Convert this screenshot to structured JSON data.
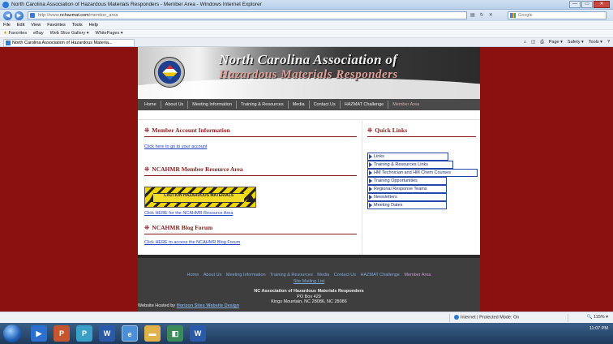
{
  "window": {
    "title": "North Carolina Association of Hazardous Materials Responders - Member Area - Windows Internet Explorer",
    "controls": [
      "—",
      "▭",
      "✕"
    ]
  },
  "address_bar": {
    "url_prefix": "http://www.",
    "url_domain": "nchazmat.com",
    "url_path": "/member_area",
    "search_placeholder": "Google"
  },
  "menu": [
    "File",
    "Edit",
    "View",
    "Favorites",
    "Tools",
    "Help"
  ],
  "favorites_bar": {
    "favorites_label": "Favorites",
    "items": [
      "eBay",
      "Web Slice Gallery ▾",
      "WhitePages ▾"
    ]
  },
  "tab": {
    "title": "North Carolina Association of Hazardous Materia..."
  },
  "command_bar": [
    "Page ▾",
    "Safety ▾",
    "Tools ▾"
  ],
  "site": {
    "banner_line1": "North Carolina Association of",
    "banner_line2": "Hazardous Materials Responders",
    "nav": [
      "Home",
      "About Us",
      "Meeting Information",
      "Training & Resources",
      "Media",
      "Contact Us",
      "HAZMAT Challenge",
      "Member Area"
    ],
    "sections": {
      "account": {
        "heading": "Member Account Information",
        "link": "Click here to go to your account"
      },
      "resources": {
        "heading": "NCAHMR Member Resource Area",
        "image_text": "CAUTION HAZARDOUS MATERIALS",
        "link": "Click HERE for the NCAHMR Resource Area"
      },
      "blog": {
        "heading": "NCAHMR Blog Forum",
        "link": "Click HERE to access the NCAHMR Blog Forum"
      }
    },
    "quick_links": {
      "heading": "Quick Links",
      "items": [
        "Links",
        "Training & Resources Links",
        "HM Technician and HM Chem Courses",
        "Training Opportunities",
        "Regional Response Teams",
        "Newsletters",
        "Meeting Dates"
      ]
    },
    "footer": {
      "nav": [
        "Home",
        "About Us",
        "Meeting Information",
        "Training & Resources",
        "Media",
        "Contact Us",
        "HAZMAT Challenge",
        "Member Area"
      ],
      "mailing_list": "Site Mailing List",
      "org_name": "NC Association of Hazardous Materials Responders",
      "po_box": "PO Box 429",
      "city": "Kings Mountain, NC 28086, NC 28086",
      "hosted_prefix": "Website Hosted by",
      "hosted_link": "Horizon Sites Website Design"
    }
  },
  "status_bar": {
    "zone": "Internet | Protected Mode: On",
    "zoom": "115%"
  },
  "taskbar": {
    "clock": "11:07 PM"
  }
}
